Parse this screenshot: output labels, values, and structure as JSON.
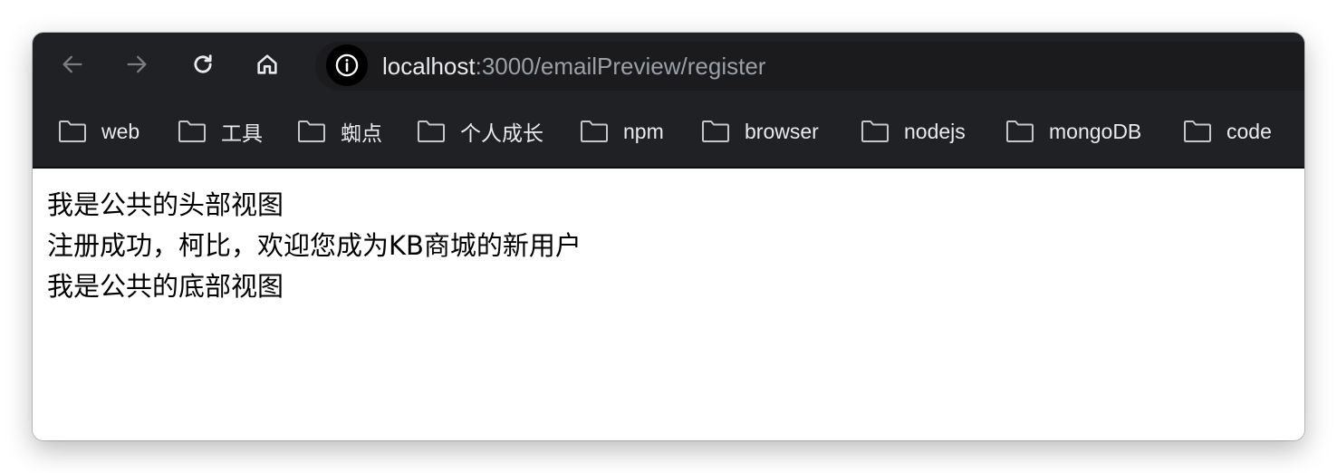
{
  "toolbar": {
    "back_icon": "arrow-left-icon",
    "forward_icon": "arrow-right-icon",
    "reload_icon": "reload-icon",
    "home_icon": "home-icon",
    "site_info_icon": "info-circle-icon",
    "url_host": "localhost",
    "url_path": ":3000/emailPreview/register"
  },
  "bookmarks": [
    {
      "label": "web",
      "icon": "folder-icon"
    },
    {
      "label": "工具",
      "icon": "folder-icon"
    },
    {
      "label": "蜘点",
      "icon": "folder-icon"
    },
    {
      "label": "个人成长",
      "icon": "folder-icon"
    },
    {
      "label": "npm",
      "icon": "folder-icon"
    },
    {
      "label": "browser",
      "icon": "folder-icon"
    },
    {
      "label": "nodejs",
      "icon": "folder-icon"
    },
    {
      "label": "mongoDB",
      "icon": "folder-icon"
    },
    {
      "label": "code",
      "icon": "folder-icon"
    }
  ],
  "page": {
    "header_text": "我是公共的头部视图",
    "body_text": "注册成功，柯比，欢迎您成为KB商城的新用户",
    "footer_text": "我是公共的底部视图"
  },
  "colors": {
    "toolbar_bg": "#202124",
    "url_host": "#e8eaed",
    "url_path": "#9aa0a6",
    "page_bg": "#ffffff"
  }
}
